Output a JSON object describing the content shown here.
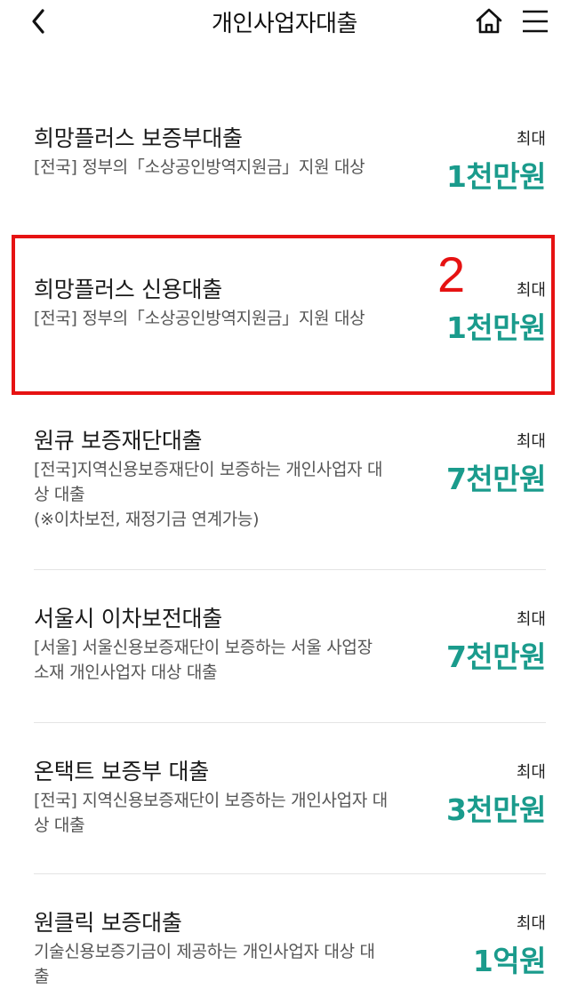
{
  "header": {
    "title": "개인사업자대출",
    "back_icon": "chevron-left-icon",
    "home_icon": "home-icon",
    "menu_icon": "hamburger-menu-icon"
  },
  "colors": {
    "accent": "#1a9b8c",
    "highlight": "#e61212"
  },
  "annotation": {
    "number": "2"
  },
  "loans": [
    {
      "title": "희망플러스 보증부대출",
      "desc": "[전국] 정부의「소상공인방역지원금」지원 대상",
      "max_label": "최대",
      "amount": "1천만원"
    },
    {
      "title": "희망플러스 신용대출",
      "desc": "[전국] 정부의「소상공인방역지원금」지원 대상",
      "max_label": "최대",
      "amount": "1천만원"
    },
    {
      "title": "원큐 보증재단대출",
      "desc": "[전국]지역신용보증재단이 보증하는 개인사업자 대상 대출",
      "desc2": "(※이차보전, 재정기금 연계가능)",
      "max_label": "최대",
      "amount": "7천만원"
    },
    {
      "title": "서울시 이차보전대출",
      "desc": "[서울] 서울신용보증재단이 보증하는 서울 사업장 소재 개인사업자 대상 대출",
      "max_label": "최대",
      "amount": "7천만원"
    },
    {
      "title": "온택트 보증부 대출",
      "desc": "[전국] 지역신용보증재단이 보증하는 개인사업자 대상 대출",
      "max_label": "최대",
      "amount": "3천만원"
    },
    {
      "title": "원클릭 보증대출",
      "desc": "기술신용보증기금이 제공하는 개인사업자 대상 대출",
      "max_label": "최대",
      "amount": "1억원"
    }
  ]
}
